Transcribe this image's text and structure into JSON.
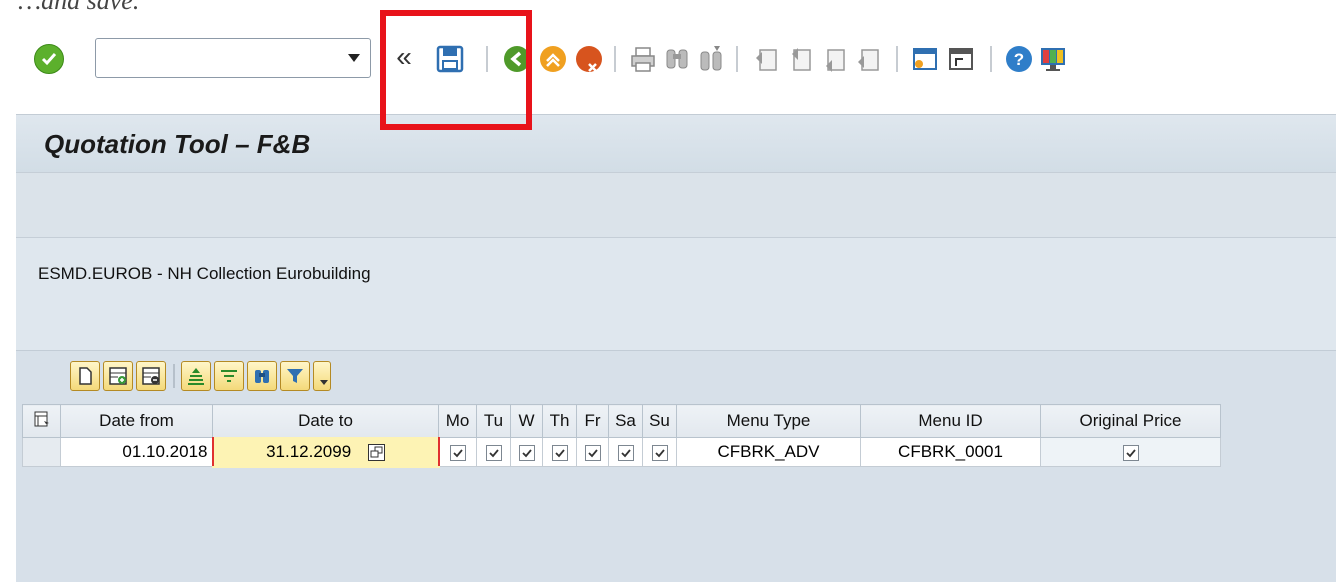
{
  "caption": "…and save.",
  "toolbar": {
    "command_value": "",
    "icons": [
      "enter-icon",
      "command-field",
      "back-chevron-icon",
      "save-icon",
      "back-icon",
      "exit-icon",
      "cancel-icon",
      "print-icon",
      "find-icon",
      "find-next-icon",
      "first-page-icon",
      "previous-page-icon",
      "next-page-icon",
      "last-page-icon",
      "create-session-icon",
      "shortcut-icon",
      "help-icon",
      "customize-layout-icon"
    ],
    "chevron": "«"
  },
  "title": "Quotation Tool – F&B",
  "hotel_label": "ESMD.EUROB - NH Collection Eurobuilding",
  "grid": {
    "columns": [
      "Date from",
      "Date to",
      "Mo",
      "Tu",
      "W",
      "Th",
      "Fr",
      "Sa",
      "Su",
      "Menu Type",
      "Menu ID",
      "Original Price"
    ],
    "rows": [
      {
        "date_from": "01.10.2018",
        "date_to": "31.12.2099",
        "mo": true,
        "tu": true,
        "w": true,
        "th": true,
        "fr": true,
        "sa": true,
        "su": true,
        "menu_type": "CFBRK_ADV",
        "menu_id": "CFBRK_0001",
        "original_price": true
      }
    ]
  },
  "colors": {
    "highlight": "#e8131a",
    "ok": "#5cb02c",
    "header_bg": "#dfe7ee",
    "edit_cell": "#fdf3b4"
  }
}
